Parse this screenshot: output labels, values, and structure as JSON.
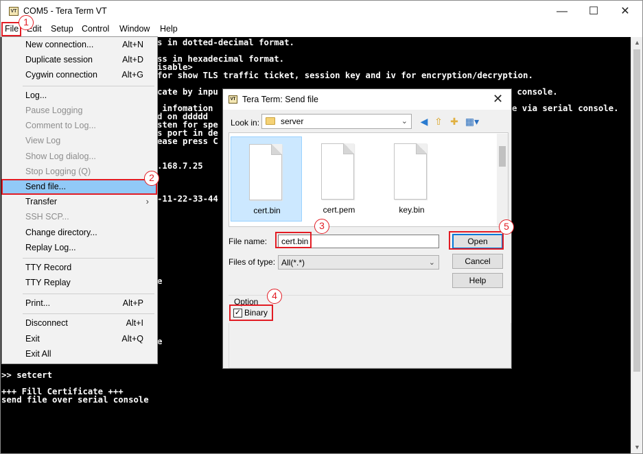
{
  "window": {
    "icon_text": "VT",
    "title": "COM5 - Tera Term VT",
    "minimize_glyph": "—",
    "maximize_glyph": "☐",
    "close_glyph": "✕"
  },
  "menubar": [
    "File",
    "Edit",
    "Setup",
    "Control",
    "Window",
    "Help"
  ],
  "terminal_lines": [
    "s in dotted-decimal format.",
    "ss in hexadecimal format.",
    "isable>",
    "for show TLS traffic ticket, session key and iv for encryption/decryption.",
    "cate by inpu",
    " console.",
    " infomation",
    "e via serial console.",
    "d on ddddd",
    "sten for spe",
    "s port in de",
    "ease press C",
    ".168.7.25",
    "-11-22-33-44",
    "e",
    "e",
    ">> setcert",
    "+++ Fill Certificate +++",
    "send file over serial console"
  ],
  "file_menu": {
    "items": [
      {
        "label": "New connection...",
        "shortcut": "Alt+N",
        "enabled": true
      },
      {
        "label": "Duplicate session",
        "shortcut": "Alt+D",
        "enabled": true
      },
      {
        "label": "Cygwin connection",
        "shortcut": "Alt+G",
        "enabled": true
      },
      {
        "label": "Log...",
        "shortcut": "",
        "enabled": true
      },
      {
        "label": "Pause Logging",
        "shortcut": "",
        "enabled": false
      },
      {
        "label": "Comment to Log...",
        "shortcut": "",
        "enabled": false
      },
      {
        "label": "View Log",
        "shortcut": "",
        "enabled": false
      },
      {
        "label": "Show Log dialog...",
        "shortcut": "",
        "enabled": false
      },
      {
        "label": "Stop Logging (Q)",
        "shortcut": "",
        "enabled": false
      },
      {
        "label": "Send file...",
        "shortcut": "",
        "enabled": true,
        "selected": true
      },
      {
        "label": "Transfer",
        "shortcut": "",
        "enabled": true,
        "submenu": true
      },
      {
        "label": "SSH SCP...",
        "shortcut": "",
        "enabled": false
      },
      {
        "label": "Change directory...",
        "shortcut": "",
        "enabled": true
      },
      {
        "label": "Replay Log...",
        "shortcut": "",
        "enabled": true
      },
      {
        "label": "TTY Record",
        "shortcut": "",
        "enabled": true
      },
      {
        "label": "TTY Replay",
        "shortcut": "",
        "enabled": true
      },
      {
        "label": "Print...",
        "shortcut": "Alt+P",
        "enabled": true
      },
      {
        "label": "Disconnect",
        "shortcut": "Alt+I",
        "enabled": true
      },
      {
        "label": "Exit",
        "shortcut": "Alt+Q",
        "enabled": true
      },
      {
        "label": "Exit All",
        "shortcut": "",
        "enabled": true
      }
    ],
    "submenu_glyph": "›"
  },
  "dialog": {
    "icon_text": "VT",
    "title": "Tera Term: Send file",
    "close_glyph": "✕",
    "look_in_label": "Look in:",
    "look_in_value": "server",
    "toolbar_icons": [
      "back-icon",
      "up-folder-icon",
      "new-folder-icon",
      "view-menu-icon"
    ],
    "files": [
      {
        "name": "cert.bin",
        "selected": true
      },
      {
        "name": "cert.pem",
        "selected": false
      },
      {
        "name": "key.bin",
        "selected": false
      }
    ],
    "file_name_label": "File name:",
    "file_name_value": "cert.bin",
    "files_of_type_label": "Files of type:",
    "files_of_type_value": "All(*.*)",
    "open_label": "Open",
    "cancel_label": "Cancel",
    "help_label": "Help",
    "option_label": "Option",
    "binary_label": "Binary",
    "binary_checked": true
  },
  "annotations": [
    "1",
    "2",
    "3",
    "4",
    "5"
  ],
  "colors": {
    "annotation": "#e21b23",
    "selection": "#91c9f7",
    "accent": "#0078d7"
  }
}
